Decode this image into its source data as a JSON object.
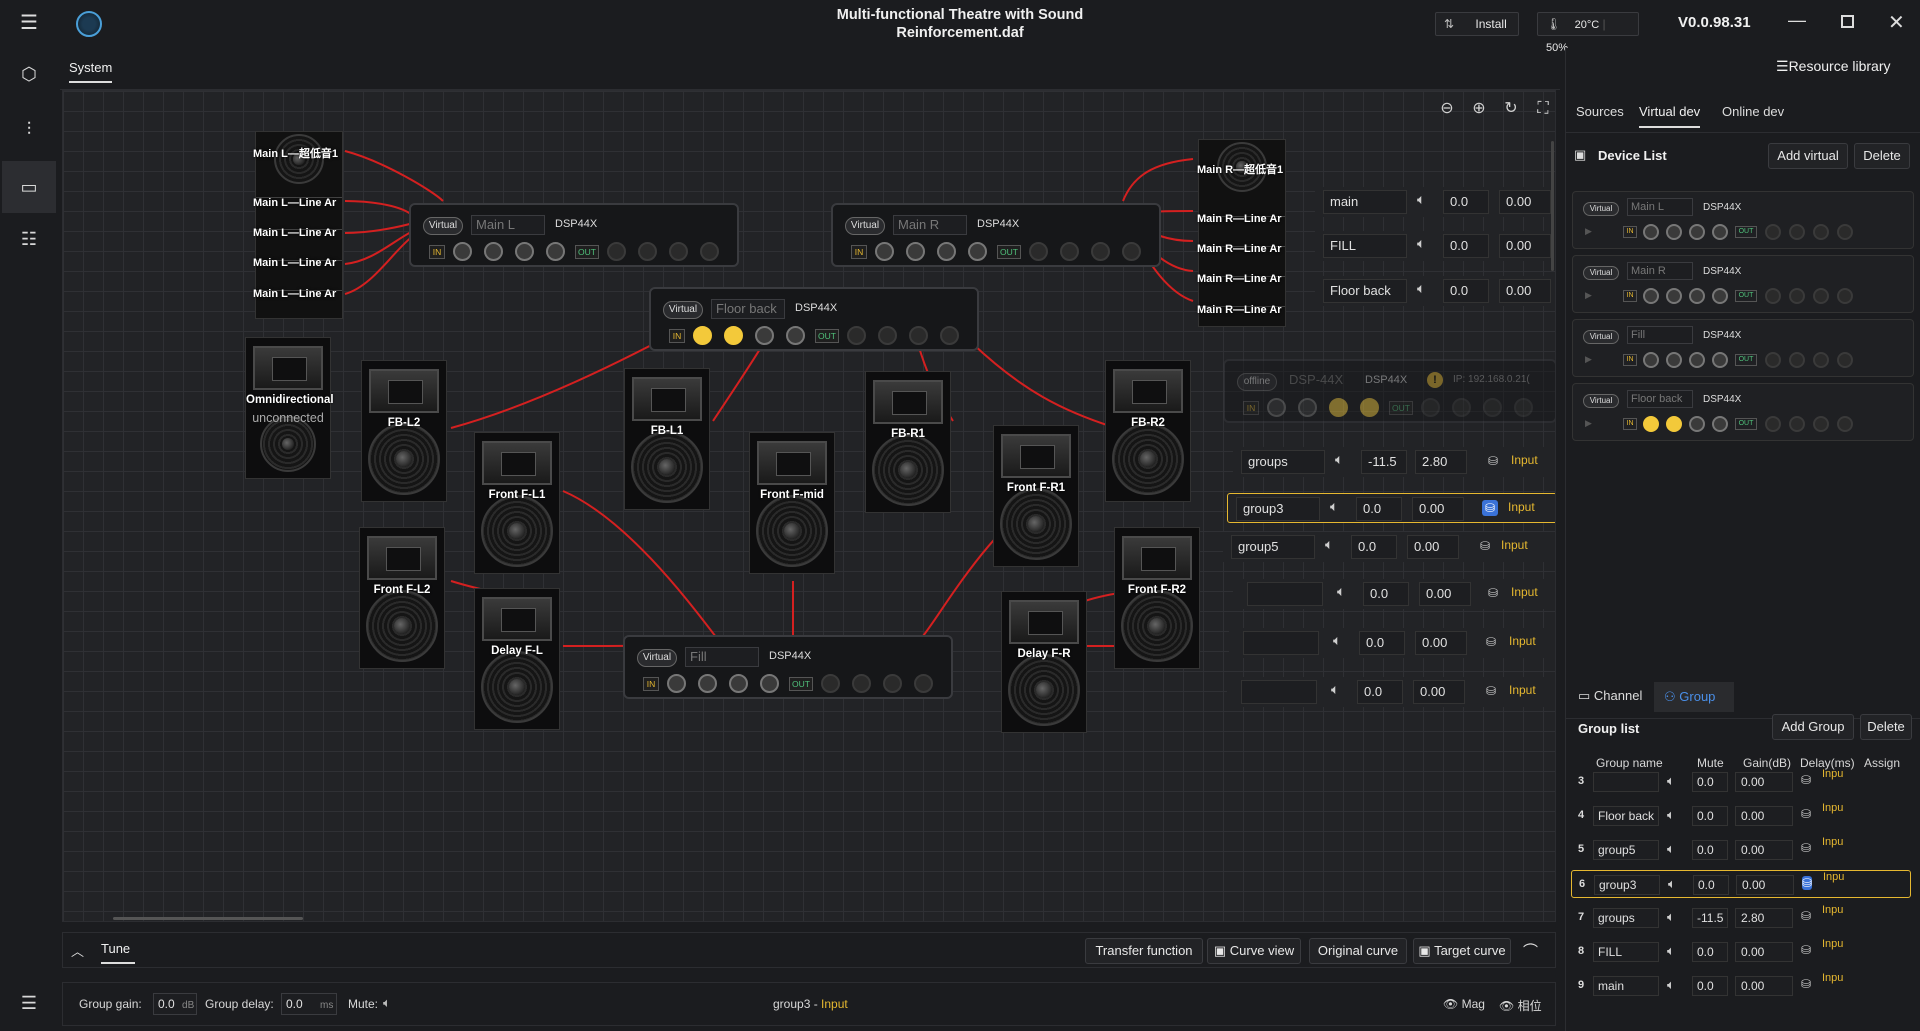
{
  "window": {
    "title_line1": "Multi-functional Theatre with Sound",
    "title_line2": "Reinforcement.daf",
    "install": "Install",
    "temp": "20°C",
    "humidity": "50%",
    "version": "V0.0.98.31"
  },
  "tab": {
    "system": "System"
  },
  "speakers": {
    "omni": "Omnidirectional",
    "omni_status": "unconnected",
    "fb_l2": "FB-L2",
    "fb_l1": "FB-L1",
    "front_f_mid": "Front F-mid",
    "fb_r1": "FB-R1",
    "fb_r2": "FB-R2",
    "front_f_l1": "Front F-L1",
    "front_f_l2": "Front F-L2",
    "delay_f_l": "Delay F-L",
    "front_f_r1": "Front F-R1",
    "front_f_r2": "Front F-R2",
    "delay_f_r": "Delay F-R"
  },
  "stacks": {
    "left": [
      "Main L—超低音1",
      "Main L—Line Ar",
      "Main L—Line Ar",
      "Main L—Line Ar",
      "Main L—Line Ar"
    ],
    "right": [
      "Main R—超低音1",
      "Main R—Line Ar",
      "Main R—Line Ar",
      "Main R—Line Ar",
      "Main R—Line Ar"
    ]
  },
  "dsp": {
    "main_l": {
      "badge": "Virtual",
      "name": "Main L",
      "model": "DSP44X",
      "in": "IN",
      "out": "OUT"
    },
    "main_r": {
      "badge": "Virtual",
      "name": "Main R",
      "model": "DSP44X",
      "in": "IN",
      "out": "OUT"
    },
    "floor_back": {
      "badge": "Virtual",
      "name": "Floor back",
      "model": "DSP44X",
      "in": "IN",
      "out": "OUT"
    },
    "fill": {
      "badge": "Virtual",
      "name": "Fill",
      "model": "DSP44X",
      "in": "IN",
      "out": "OUT"
    },
    "offline": {
      "badge": "offline",
      "name": "DSP-44X",
      "model": "DSP44X",
      "ip": "IP: 192.168.0.21(",
      "in": "IN",
      "out": "OUT"
    }
  },
  "canvas_groups": [
    {
      "name": "main",
      "gain": "0.0",
      "delay": "0.00"
    },
    {
      "name": "FILL",
      "gain": "0.0",
      "delay": "0.00"
    },
    {
      "name": "Floor back",
      "gain": "0.0",
      "delay": "0.00"
    },
    {
      "name": "groups",
      "gain": "-11.5",
      "delay": "2.80",
      "input": "Input"
    },
    {
      "name": "group3",
      "gain": "0.0",
      "delay": "0.00",
      "input": "Input"
    },
    {
      "name": "group5",
      "gain": "0.0",
      "delay": "0.00",
      "input": "Input"
    },
    {
      "name": "",
      "gain": "0.0",
      "delay": "0.00",
      "input": "Input"
    },
    {
      "name": "",
      "gain": "0.0",
      "delay": "0.00",
      "input": "Input"
    },
    {
      "name": "",
      "gain": "0.0",
      "delay": "0.00",
      "input": "Input"
    }
  ],
  "right_panel": {
    "resource_library": "Resource library",
    "tabs": [
      "Sources",
      "Virtual dev",
      "Online dev"
    ],
    "device_list": "Device List",
    "add_virtual": "Add virtual",
    "delete": "Delete",
    "devices": [
      {
        "badge": "Virtual",
        "name": "Main L",
        "model": "DSP44X",
        "in": "IN",
        "out": "OUT"
      },
      {
        "badge": "Virtual",
        "name": "Main R",
        "model": "DSP44X",
        "in": "IN",
        "out": "OUT"
      },
      {
        "badge": "Virtual",
        "name": "Fill",
        "model": "DSP44X",
        "in": "IN",
        "out": "OUT"
      },
      {
        "badge": "Virtual",
        "name": "Floor back",
        "model": "DSP44X",
        "in": "IN",
        "out": "OUT"
      }
    ],
    "channel_tab": "Channel",
    "group_tab": "Group",
    "group_list": "Group list",
    "add_group": "Add Group",
    "delete_group": "Delete",
    "cols": {
      "name": "Group name",
      "mute": "Mute",
      "gain": "Gain(dB)",
      "delay": "Delay(ms)",
      "assign": "Assign"
    },
    "rows": [
      {
        "idx": "3",
        "name": "",
        "gain": "0.0",
        "delay": "0.00",
        "input": "Inpu"
      },
      {
        "idx": "4",
        "name": "Floor back",
        "gain": "0.0",
        "delay": "0.00",
        "input": "Inpu"
      },
      {
        "idx": "5",
        "name": "group5",
        "gain": "0.0",
        "delay": "0.00",
        "input": "Inpu"
      },
      {
        "idx": "6",
        "name": "group3",
        "gain": "0.0",
        "delay": "0.00",
        "input": "Inpu"
      },
      {
        "idx": "7",
        "name": "groups",
        "gain": "-11.5",
        "delay": "2.80",
        "input": "Inpu"
      },
      {
        "idx": "8",
        "name": "FILL",
        "gain": "0.0",
        "delay": "0.00",
        "input": "Inpu"
      },
      {
        "idx": "9",
        "name": "main",
        "gain": "0.0",
        "delay": "0.00",
        "input": "Inpu"
      }
    ]
  },
  "tune": {
    "label": "Tune",
    "transfer": "Transfer function",
    "curve_view": "Curve view",
    "original_curve": "Original curve",
    "target_curve": "Target curve"
  },
  "status": {
    "group_gain_label": "Group gain:",
    "group_gain": "0.0",
    "db": "dB",
    "group_delay_label": "Group delay:",
    "group_delay": "0.0",
    "ms": "ms",
    "mute_label": "Mute:",
    "selection": "group3",
    "selection_sep": " - ",
    "selection_input": "Input",
    "mag": "Mag",
    "phase": "相位"
  }
}
